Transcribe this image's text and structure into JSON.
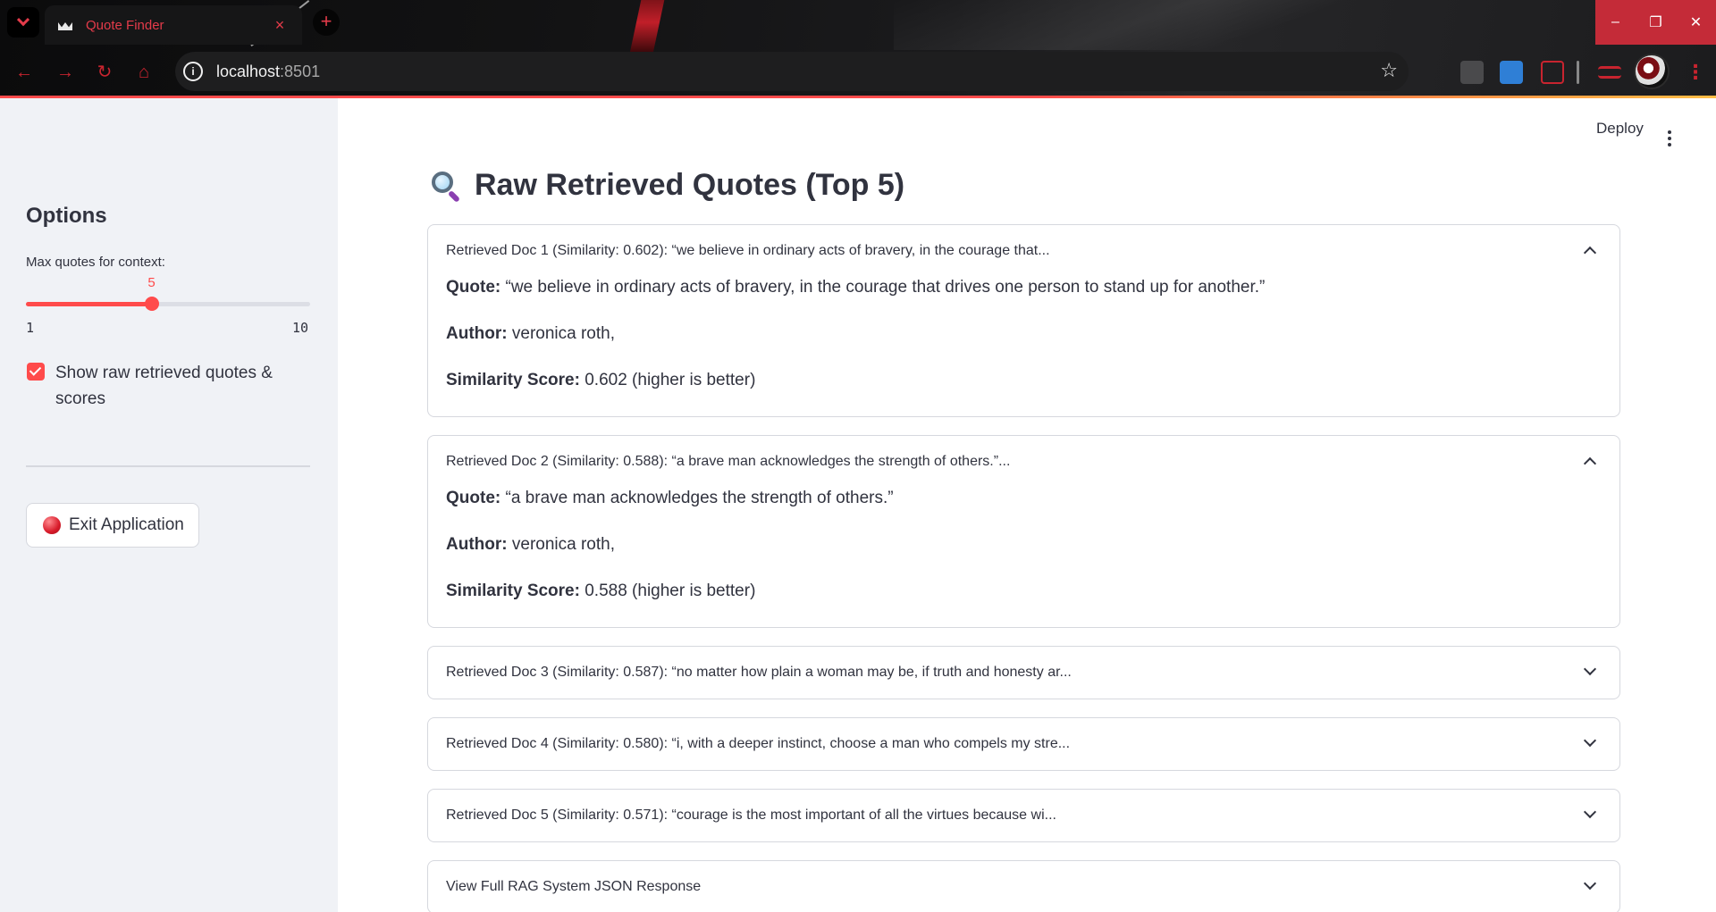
{
  "browser": {
    "tab_title": "Quote Finder",
    "tab_close": "×",
    "new_tab": "+",
    "url_host": "localhost",
    "url_port": ":8501",
    "window_controls": [
      "–",
      "❐",
      "✕"
    ]
  },
  "app": {
    "deploy_label": "Deploy",
    "sidebar": {
      "heading": "Options",
      "slider": {
        "label": "Max quotes for context:",
        "value": 5,
        "value_label": "5",
        "min": 1,
        "min_label": "1",
        "max": 10,
        "max_label": "10"
      },
      "checkbox": {
        "label": "Show raw retrieved quotes & scores",
        "checked": true
      },
      "exit_button": "Exit Application"
    },
    "page_title": "Raw Retrieved Quotes (Top 5)",
    "labels": {
      "quote": "Quote:",
      "author": "Author:",
      "similarity": "Similarity Score:"
    },
    "expanders": [
      {
        "header": "Retrieved Doc 1 (Similarity: 0.602): “we believe in ordinary acts of bravery, in the courage that...",
        "expanded": true,
        "quote": "“we believe in ordinary acts of bravery, in the courage that drives one person to stand up for another.”",
        "author": "veronica roth,",
        "score": "0.602 (higher is better)"
      },
      {
        "header": "Retrieved Doc 2 (Similarity: 0.588): “a brave man acknowledges the strength of others.”...",
        "expanded": true,
        "quote": "“a brave man acknowledges the strength of others.”",
        "author": "veronica roth,",
        "score": "0.588 (higher is better)"
      },
      {
        "header": "Retrieved Doc 3 (Similarity: 0.587): “no matter how plain a woman may be, if truth and honesty ar...",
        "expanded": false
      },
      {
        "header": "Retrieved Doc 4 (Similarity: 0.580): “i, with a deeper instinct, choose a man who compels my stre...",
        "expanded": false
      },
      {
        "header": "Retrieved Doc 5 (Similarity: 0.571): “courage is the most important of all the virtues because wi...",
        "expanded": false
      },
      {
        "header": "View Full RAG System JSON Response",
        "expanded": false
      }
    ]
  }
}
